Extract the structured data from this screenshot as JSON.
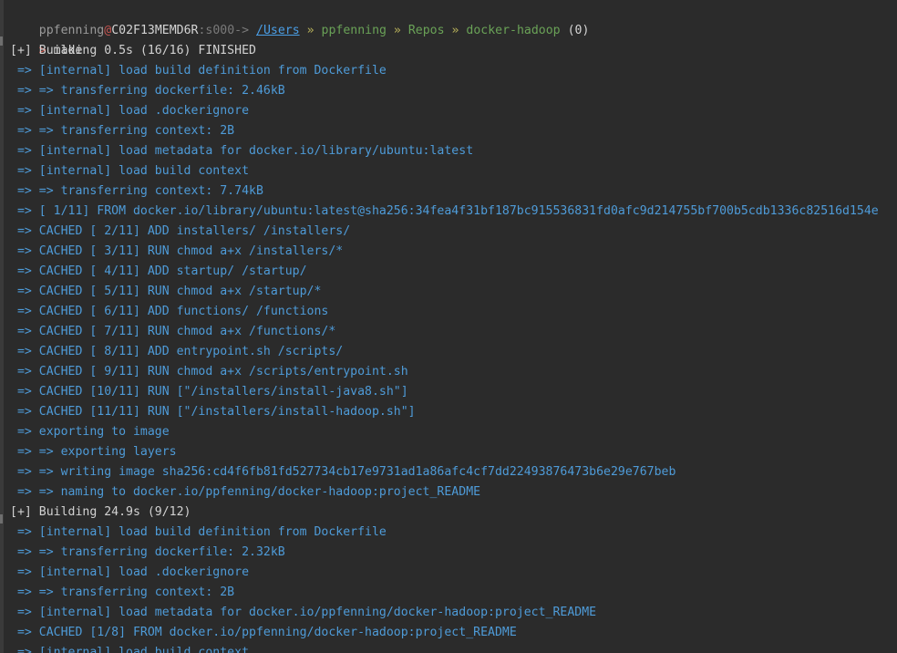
{
  "prompt": {
    "user": "ppfenning",
    "at": "@",
    "host": "C02F13MEMD6R",
    "session": ":s000->",
    "path": [
      {
        "text": "/Users",
        "link": true
      },
      {
        "text": "ppfenning",
        "link": false
      },
      {
        "text": "Repos",
        "link": false
      },
      {
        "text": "docker-hadoop",
        "link": false
      }
    ],
    "separator": "»",
    "status": "(0)",
    "arrow": ">",
    "command": "make"
  },
  "output": [
    {
      "kind": "header",
      "text": "[+] Building 0.5s (16/16) FINISHED"
    },
    {
      "kind": "step",
      "text": " => [internal] load build definition from Dockerfile"
    },
    {
      "kind": "step",
      "text": " => => transferring dockerfile: 2.46kB"
    },
    {
      "kind": "step",
      "text": " => [internal] load .dockerignore"
    },
    {
      "kind": "step",
      "text": " => => transferring context: 2B"
    },
    {
      "kind": "step",
      "text": " => [internal] load metadata for docker.io/library/ubuntu:latest"
    },
    {
      "kind": "step",
      "text": " => [internal] load build context"
    },
    {
      "kind": "step",
      "text": " => => transferring context: 7.74kB"
    },
    {
      "kind": "step",
      "text": " => [ 1/11] FROM docker.io/library/ubuntu:latest@sha256:34fea4f31bf187bc915536831fd0afc9d214755bf700b5cdb1336c82516d154e"
    },
    {
      "kind": "step",
      "text": " => CACHED [ 2/11] ADD installers/ /installers/"
    },
    {
      "kind": "step",
      "text": " => CACHED [ 3/11] RUN chmod a+x /installers/*"
    },
    {
      "kind": "step",
      "text": " => CACHED [ 4/11] ADD startup/ /startup/"
    },
    {
      "kind": "step",
      "text": " => CACHED [ 5/11] RUN chmod a+x /startup/*"
    },
    {
      "kind": "step",
      "text": " => CACHED [ 6/11] ADD functions/ /functions"
    },
    {
      "kind": "step",
      "text": " => CACHED [ 7/11] RUN chmod a+x /functions/*"
    },
    {
      "kind": "step",
      "text": " => CACHED [ 8/11] ADD entrypoint.sh /scripts/"
    },
    {
      "kind": "step",
      "text": " => CACHED [ 9/11] RUN chmod a+x /scripts/entrypoint.sh"
    },
    {
      "kind": "step",
      "text": " => CACHED [10/11] RUN [\"/installers/install-java8.sh\"]"
    },
    {
      "kind": "step",
      "text": " => CACHED [11/11] RUN [\"/installers/install-hadoop.sh\"]"
    },
    {
      "kind": "step",
      "text": " => exporting to image"
    },
    {
      "kind": "step",
      "text": " => => exporting layers"
    },
    {
      "kind": "step",
      "text": " => => writing image sha256:cd4f6fb81fd527734cb17e9731ad1a86afc4cf7dd22493876473b6e29e767beb"
    },
    {
      "kind": "step",
      "text": " => => naming to docker.io/ppfenning/docker-hadoop:project_README"
    },
    {
      "kind": "header",
      "text": "[+] Building 24.9s (9/12)"
    },
    {
      "kind": "step",
      "text": " => [internal] load build definition from Dockerfile"
    },
    {
      "kind": "step",
      "text": " => => transferring dockerfile: 2.32kB"
    },
    {
      "kind": "step",
      "text": " => [internal] load .dockerignore"
    },
    {
      "kind": "step",
      "text": " => => transferring context: 2B"
    },
    {
      "kind": "step",
      "text": " => [internal] load metadata for docker.io/ppfenning/docker-hadoop:project_README"
    },
    {
      "kind": "step",
      "text": " => CACHED [1/8] FROM docker.io/ppfenning/docker-hadoop:project_README"
    },
    {
      "kind": "step",
      "text": " => [internal] load build context"
    }
  ]
}
